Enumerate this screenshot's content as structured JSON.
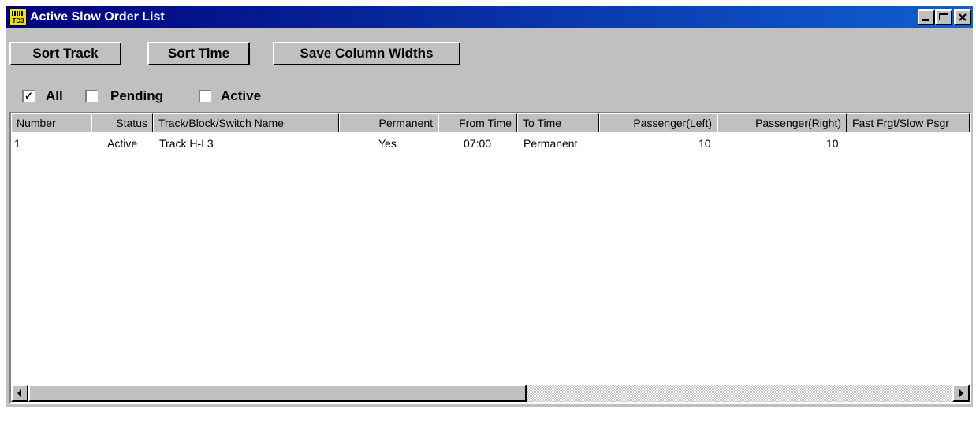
{
  "window": {
    "title": "Active Slow Order List",
    "icon_text": "TD3",
    "controls": [
      "minimize-icon",
      "maximize-icon",
      "close-icon"
    ]
  },
  "toolbar": {
    "sort_track": "Sort Track",
    "sort_time": "Sort Time",
    "save_widths": "Save Column Widths"
  },
  "filters": {
    "all": {
      "label": "All",
      "checked": true
    },
    "pending": {
      "label": "Pending",
      "checked": false
    },
    "active": {
      "label": "Active",
      "checked": false
    }
  },
  "table": {
    "columns": [
      "Number",
      "Status",
      "Track/Block/Switch Name",
      "Permanent",
      "From Time",
      "To Time",
      "Passenger(Left)",
      "Passenger(Right)",
      "Fast Frgt/Slow Psgr"
    ],
    "rows": [
      [
        "1",
        "Active",
        "Track H-I 3",
        "Yes",
        "07:00",
        "Permanent",
        "10",
        "10",
        ""
      ]
    ]
  },
  "colors": {
    "title_start": "#00007b",
    "title_end": "#1060d0",
    "face": "#c0c0c0"
  }
}
